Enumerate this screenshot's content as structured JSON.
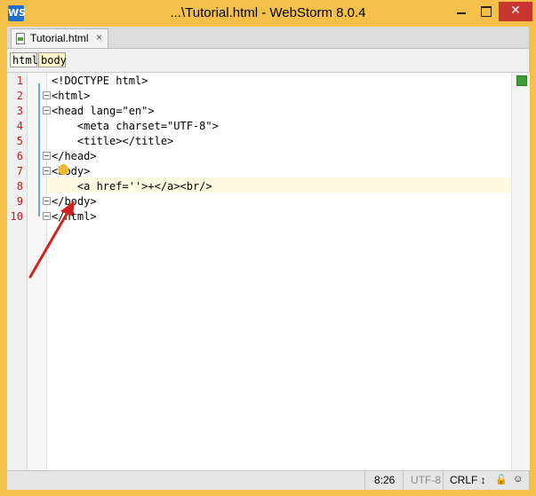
{
  "window": {
    "title": "...\\Tutorial.html - WebStorm 8.0.4",
    "app_icon": "WS"
  },
  "tabs": [
    {
      "label": "Tutorial.html",
      "close": "×"
    }
  ],
  "breadcrumbs": [
    "html",
    "body"
  ],
  "gutter": {
    "line_numbers": [
      "1",
      "2",
      "3",
      "4",
      "5",
      "6",
      "7",
      "8",
      "9",
      "10"
    ]
  },
  "code_lines": [
    "<!DOCTYPE html>",
    "<html>",
    "<head lang=\"en\">",
    "    <meta charset=\"UTF-8\">",
    "    <title></title>",
    "</head>",
    "<body>",
    "    <a href=''>+</a><br/>",
    "</body>",
    "</html>"
  ],
  "status": {
    "position": "8:26",
    "encoding": "UTF-8",
    "line_separator": "CRLF ↕"
  },
  "colors": {
    "line_number": "#c02020",
    "keyword": "#000080",
    "string": "#008000",
    "current_line": "#fdfbe0",
    "title_bar": "#f4c04a"
  }
}
